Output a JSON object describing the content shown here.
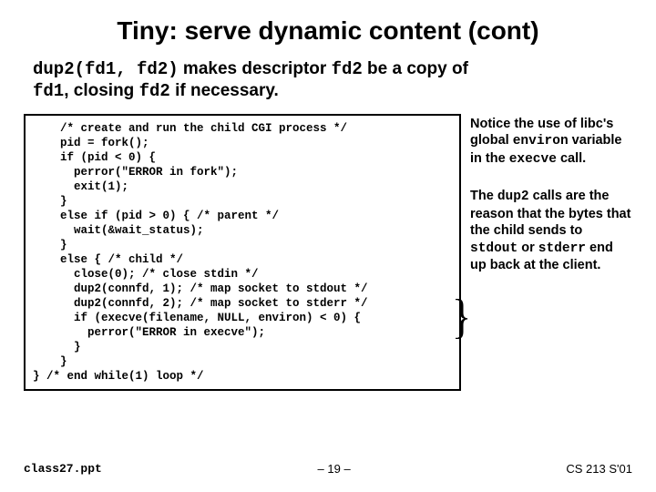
{
  "title": "Tiny: serve dynamic content (cont)",
  "intro": {
    "p1a": "dup2(fd1, fd2)",
    "p1b": " makes descriptor ",
    "p1c": "fd2",
    "p1d": " be a copy of ",
    "p2a": "fd1",
    "p2b": ", closing ",
    "p2c": "fd2",
    "p2d": " if necessary."
  },
  "code": "    /* create and run the child CGI process */\n    pid = fork();\n    if (pid < 0) {\n      perror(\"ERROR in fork\");\n      exit(1);\n    }\n    else if (pid > 0) { /* parent */\n      wait(&wait_status);\n    }\n    else { /* child */\n      close(0); /* close stdin */\n      dup2(connfd, 1); /* map socket to stdout */\n      dup2(connfd, 2); /* map socket to stderr */\n      if (execve(filename, NULL, environ) < 0) {\n        perror(\"ERROR in execve\");\n      }\n    }\n} /* end while(1) loop */",
  "side1": {
    "a": "Notice the use of libc's global ",
    "b": "environ",
    "c": " variable in the ",
    "d": "execve",
    "e": " call."
  },
  "side2": {
    "a": "The ",
    "b": "dup2",
    "c": " calls are the reason that the bytes that the child sends to ",
    "d": "stdout",
    "e": " or ",
    "f": "stderr",
    "g": " end up back at the client."
  },
  "footer": {
    "fname": "class27.ppt",
    "page": "– 19 –",
    "course": "CS 213 S'01"
  },
  "brace": "}"
}
